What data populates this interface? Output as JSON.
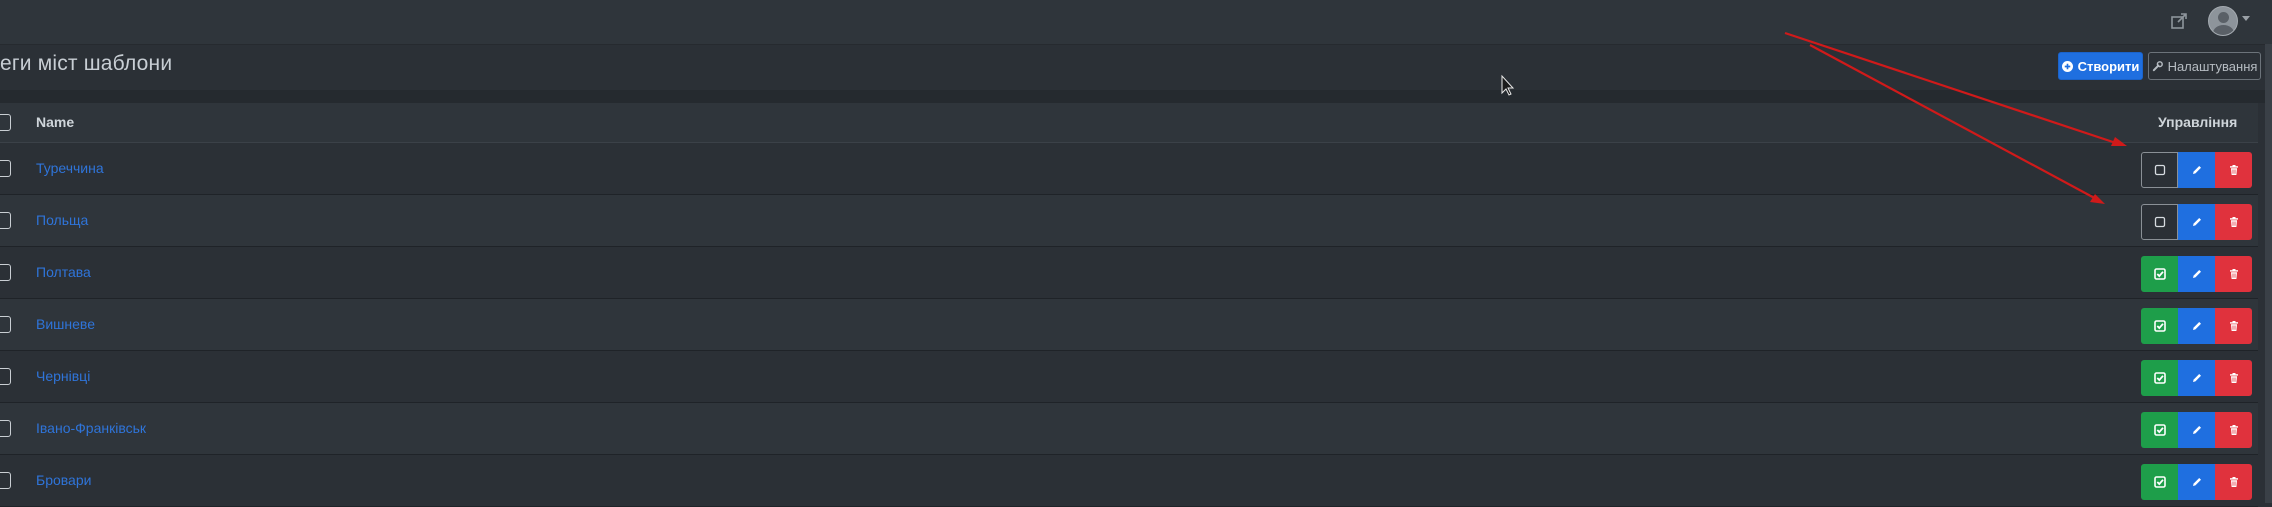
{
  "page": {
    "title": "еги міст шаблони"
  },
  "toolbar": {
    "create_label": "Створити",
    "settings_label": "Налаштування"
  },
  "table": {
    "columns": {
      "name": "Name",
      "actions": "Управління"
    },
    "rows": [
      {
        "name": "Туреччина",
        "active": false
      },
      {
        "name": "Польща",
        "active": false
      },
      {
        "name": "Полтава",
        "active": true
      },
      {
        "name": "Вишневе",
        "active": true
      },
      {
        "name": "Чернівці",
        "active": true
      },
      {
        "name": "Івано-Франківськ",
        "active": true
      },
      {
        "name": "Бровари",
        "active": true
      }
    ]
  },
  "icons": {
    "topbar": [
      "external-link-icon",
      "user-avatar-icon",
      "chevron-down-icon"
    ],
    "row_actions": [
      "toggle-icon",
      "pencil-icon",
      "trash-icon"
    ],
    "toolbar": [
      "plus-circle-icon",
      "wrench-icon"
    ]
  },
  "colors": {
    "primary": "#1f6fe0",
    "success": "#1e9e4a",
    "danger": "#e0323d",
    "link": "#2f74d9",
    "annotation_arrow": "#d01a1a"
  }
}
